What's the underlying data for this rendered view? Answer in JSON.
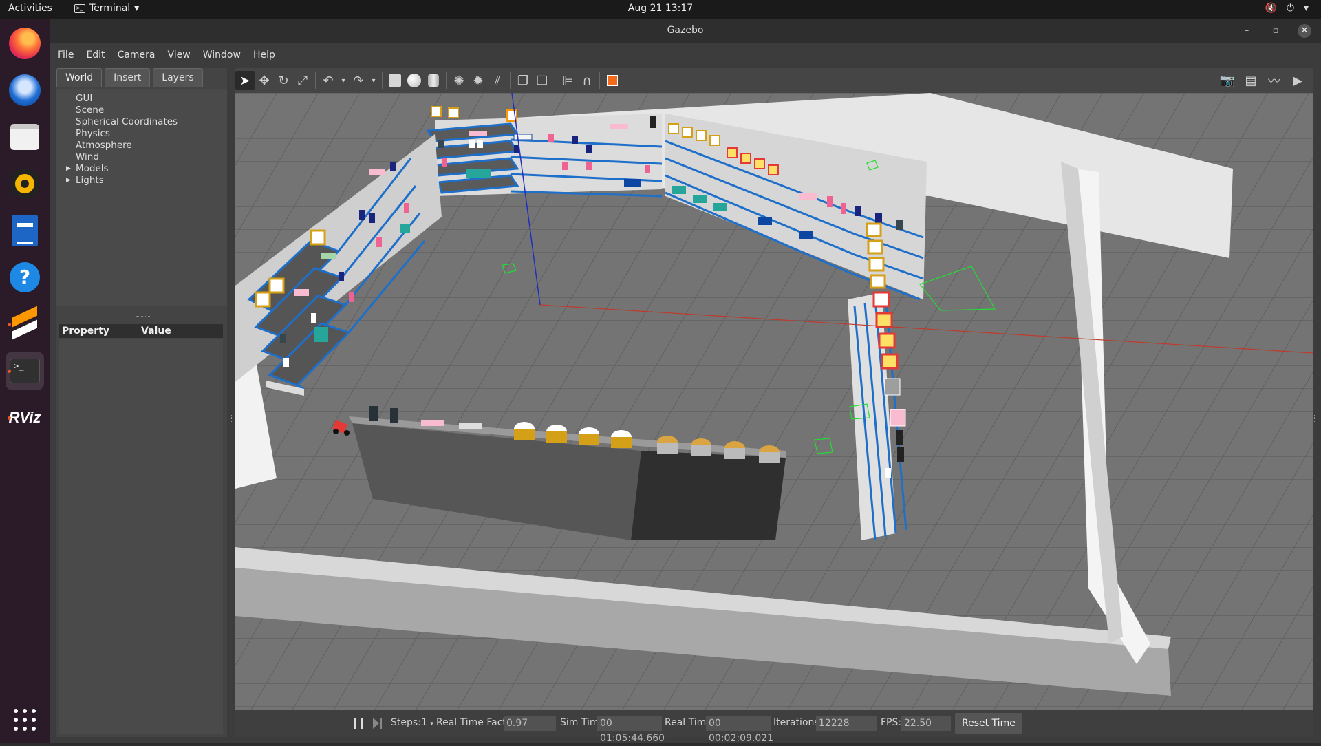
{
  "topbar": {
    "activities": "Activities",
    "app_menu": "Terminal",
    "clock": "Aug 21  13:17"
  },
  "window": {
    "title": "Gazebo"
  },
  "menu": {
    "file": "File",
    "edit": "Edit",
    "camera": "Camera",
    "view": "View",
    "window": "Window",
    "help": "Help"
  },
  "panel": {
    "tabs": [
      "World",
      "Insert",
      "Layers"
    ],
    "tree": [
      "GUI",
      "Scene",
      "Spherical Coordinates",
      "Physics",
      "Atmosphere",
      "Wind",
      "Models",
      "Lights"
    ],
    "prop_header": "Property",
    "value_header": "Value"
  },
  "status": {
    "steps_label": "Steps:",
    "steps_value": "1",
    "rtf_label": "Real Time Factor:",
    "rtf_value": "0.97",
    "sim_label": "Sim Time:",
    "sim_value": "00 01:05:44.660",
    "real_label": "Real Time:",
    "real_value": "00 00:02:09.021",
    "iter_label": "Iterations:",
    "iter_value": "12228",
    "fps_label": "FPS:",
    "fps_value": "22.50",
    "reset_label": "Reset Time"
  },
  "dock": {
    "rviz_label": "RViz"
  },
  "colors": {
    "shelf_blue": "#1e6fc9",
    "floor": "#737373",
    "wall": "#e8e8e8",
    "x_axis": "#c0392b",
    "z_axis": "#1f2fbf",
    "marker_green": "#22dd33"
  }
}
